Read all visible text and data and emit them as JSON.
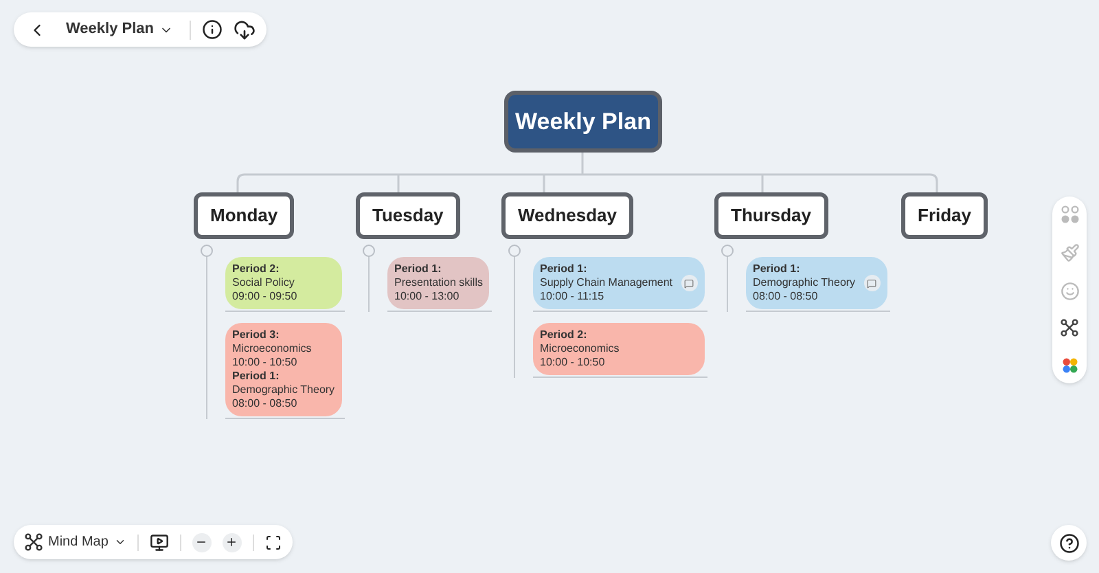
{
  "top_bar": {
    "title": "Weekly Plan"
  },
  "root": {
    "title": "Weekly Plan"
  },
  "days": [
    {
      "name": "Monday",
      "topics": [
        {
          "color": "#d4eb9f",
          "note": false,
          "periods": [
            {
              "label": "Period 2:",
              "subject": "Social Policy",
              "time": "09:00 - 09:50"
            }
          ]
        },
        {
          "color": "#f9b6ab",
          "note": false,
          "periods": [
            {
              "label": "Period 3:",
              "subject": "Microeconomics",
              "time": "10:00 - 10:50"
            },
            {
              "label": "Period 1:",
              "subject": "Demographic Theory",
              "time": "08:00 - 08:50"
            }
          ]
        }
      ]
    },
    {
      "name": "Tuesday",
      "topics": [
        {
          "color": "#e2c4c4",
          "note": false,
          "periods": [
            {
              "label": "Period 1:",
              "subject": "Presentation skills",
              "time": "10:00 - 13:00"
            }
          ]
        }
      ]
    },
    {
      "name": "Wednesday",
      "topics": [
        {
          "color": "#bcdcf0",
          "note": true,
          "periods": [
            {
              "label": "Period 1:",
              "subject": "Supply Chain Management",
              "time": "10:00 - 11:15"
            }
          ]
        },
        {
          "color": "#f9b6ab",
          "note": false,
          "periods": [
            {
              "label": "Period 2:",
              "subject": "Microeconomics",
              "time": "10:00 - 10:50"
            }
          ]
        }
      ]
    },
    {
      "name": "Thursday",
      "topics": [
        {
          "color": "#bcdcf0",
          "note": true,
          "periods": [
            {
              "label": "Period 1:",
              "subject": "Demographic Theory",
              "time": "08:00 - 08:50"
            }
          ]
        }
      ]
    },
    {
      "name": "Friday"
    }
  ],
  "bottom_bar": {
    "view": "Mind Map"
  }
}
